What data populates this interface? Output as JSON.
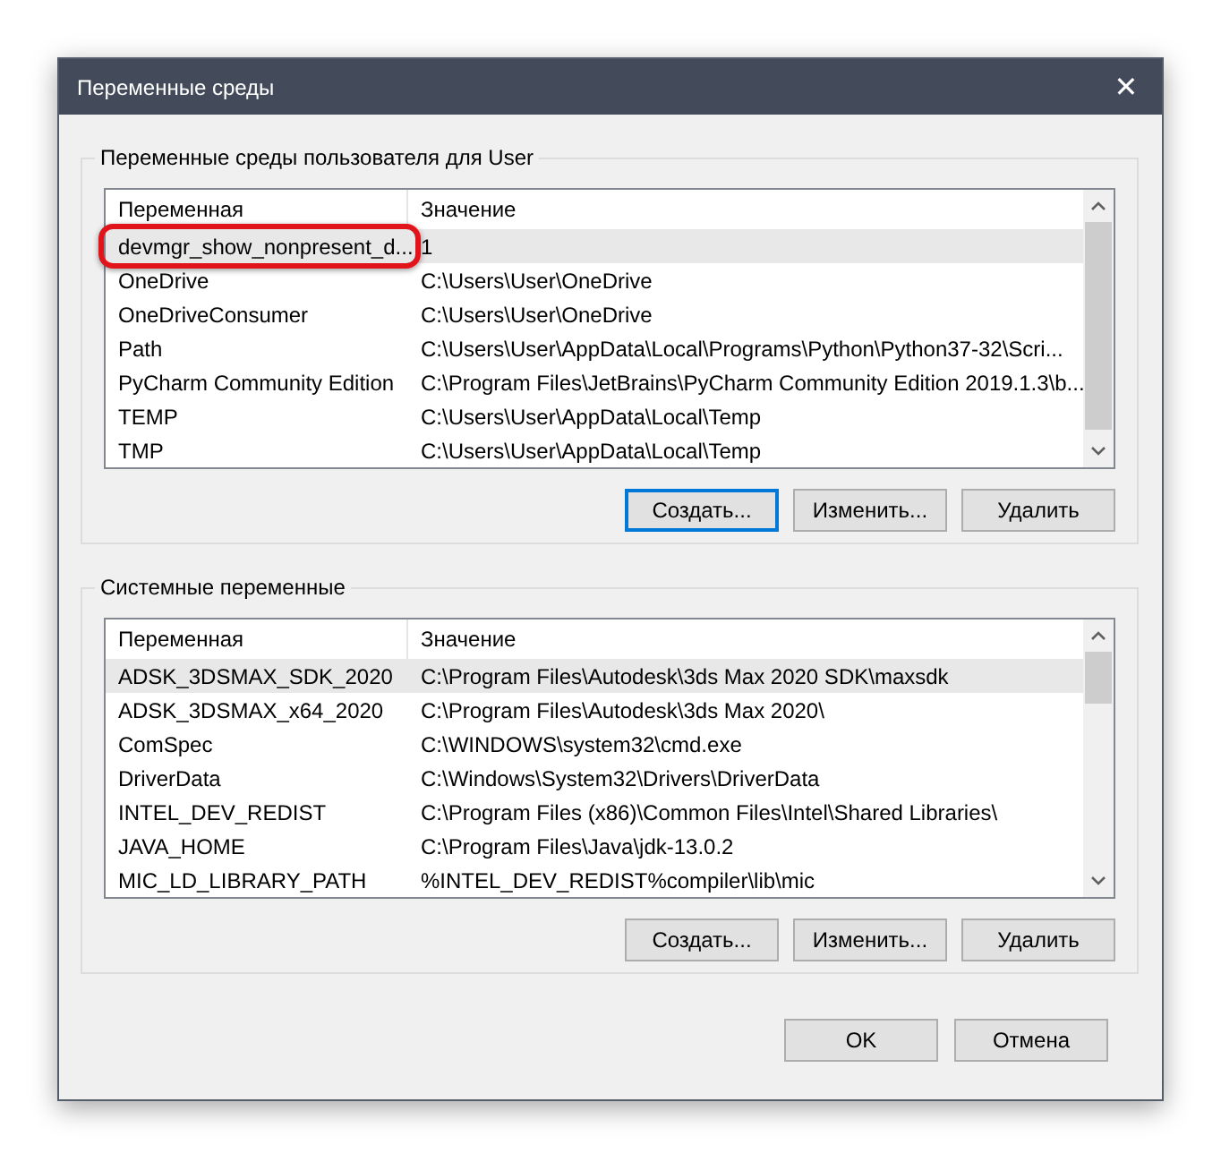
{
  "window": {
    "title": "Переменные среды",
    "close": "✕"
  },
  "groups": [
    {
      "label": "Переменные среды пользователя для User",
      "columns": [
        "Переменная",
        "Значение"
      ],
      "rows": [
        {
          "cells": [
            "devmgr_show_nonpresent_d...",
            "1"
          ],
          "selected": true,
          "highlighted": true
        },
        {
          "cells": [
            "OneDrive",
            "C:\\Users\\User\\OneDrive"
          ],
          "selected": false,
          "highlighted": false
        },
        {
          "cells": [
            "OneDriveConsumer",
            "C:\\Users\\User\\OneDrive"
          ],
          "selected": false,
          "highlighted": false
        },
        {
          "cells": [
            "Path",
            "C:\\Users\\User\\AppData\\Local\\Programs\\Python\\Python37-32\\Scri..."
          ],
          "selected": false,
          "highlighted": false
        },
        {
          "cells": [
            "PyCharm Community Edition",
            "C:\\Program Files\\JetBrains\\PyCharm Community Edition 2019.1.3\\b..."
          ],
          "selected": false,
          "highlighted": false
        },
        {
          "cells": [
            "TEMP",
            "C:\\Users\\User\\AppData\\Local\\Temp"
          ],
          "selected": false,
          "highlighted": false
        },
        {
          "cells": [
            "TMP",
            "C:\\Users\\User\\AppData\\Local\\Temp"
          ],
          "selected": false,
          "highlighted": false
        }
      ],
      "buttons": [
        {
          "label": "Создать...",
          "focused": true
        },
        {
          "label": "Изменить...",
          "focused": false
        },
        {
          "label": "Удалить",
          "focused": false
        }
      ]
    },
    {
      "label": "Системные переменные",
      "columns": [
        "Переменная",
        "Значение"
      ],
      "rows": [
        {
          "cells": [
            "ADSK_3DSMAX_SDK_2020",
            "C:\\Program Files\\Autodesk\\3ds Max 2020 SDK\\maxsdk"
          ],
          "selected": true,
          "highlighted": false
        },
        {
          "cells": [
            "ADSK_3DSMAX_x64_2020",
            "C:\\Program Files\\Autodesk\\3ds Max 2020\\"
          ],
          "selected": false,
          "highlighted": false
        },
        {
          "cells": [
            "ComSpec",
            "C:\\WINDOWS\\system32\\cmd.exe"
          ],
          "selected": false,
          "highlighted": false
        },
        {
          "cells": [
            "DriverData",
            "C:\\Windows\\System32\\Drivers\\DriverData"
          ],
          "selected": false,
          "highlighted": false
        },
        {
          "cells": [
            "INTEL_DEV_REDIST",
            "C:\\Program Files (x86)\\Common Files\\Intel\\Shared Libraries\\"
          ],
          "selected": false,
          "highlighted": false
        },
        {
          "cells": [
            "JAVA_HOME",
            "C:\\Program Files\\Java\\jdk-13.0.2"
          ],
          "selected": false,
          "highlighted": false
        },
        {
          "cells": [
            "MIC_LD_LIBRARY_PATH",
            "%INTEL_DEV_REDIST%compiler\\lib\\mic"
          ],
          "selected": false,
          "highlighted": false
        }
      ],
      "buttons": [
        {
          "label": "Создать...",
          "focused": false
        },
        {
          "label": "Изменить...",
          "focused": false
        },
        {
          "label": "Удалить",
          "focused": false
        }
      ]
    }
  ],
  "footer_buttons": [
    "OK",
    "Отмена"
  ]
}
